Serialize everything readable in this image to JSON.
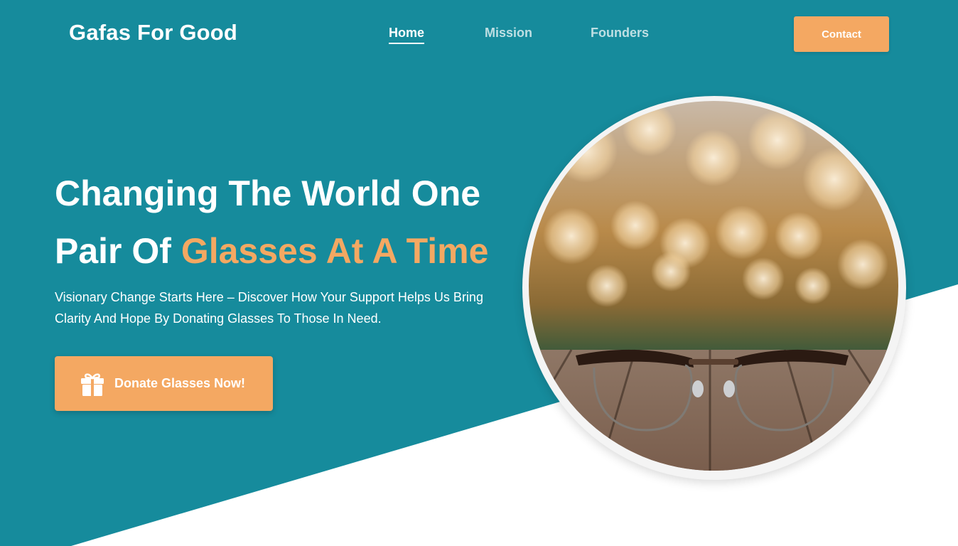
{
  "brand": {
    "name": "Gafas For Good"
  },
  "nav": {
    "items": [
      {
        "label": "Home"
      },
      {
        "label": "Mission"
      },
      {
        "label": "Founders"
      }
    ],
    "contact_label": "Contact"
  },
  "hero": {
    "title_line1": "Changing The World One",
    "title_line2_prefix": "Pair Of ",
    "title_line2_accent": "Glasses At A Time",
    "subtitle": "Visionary Change Starts Here – Discover How Your Support Helps Us Bring Clarity And Hope By Donating Glasses To Those In Need.",
    "cta_label": "Donate Glasses Now!",
    "cta_icon": "gift-icon"
  },
  "image": {
    "alt": ""
  },
  "colors": {
    "primary": "#168b9c",
    "accent": "#f4a862",
    "background": "#ffffff"
  }
}
